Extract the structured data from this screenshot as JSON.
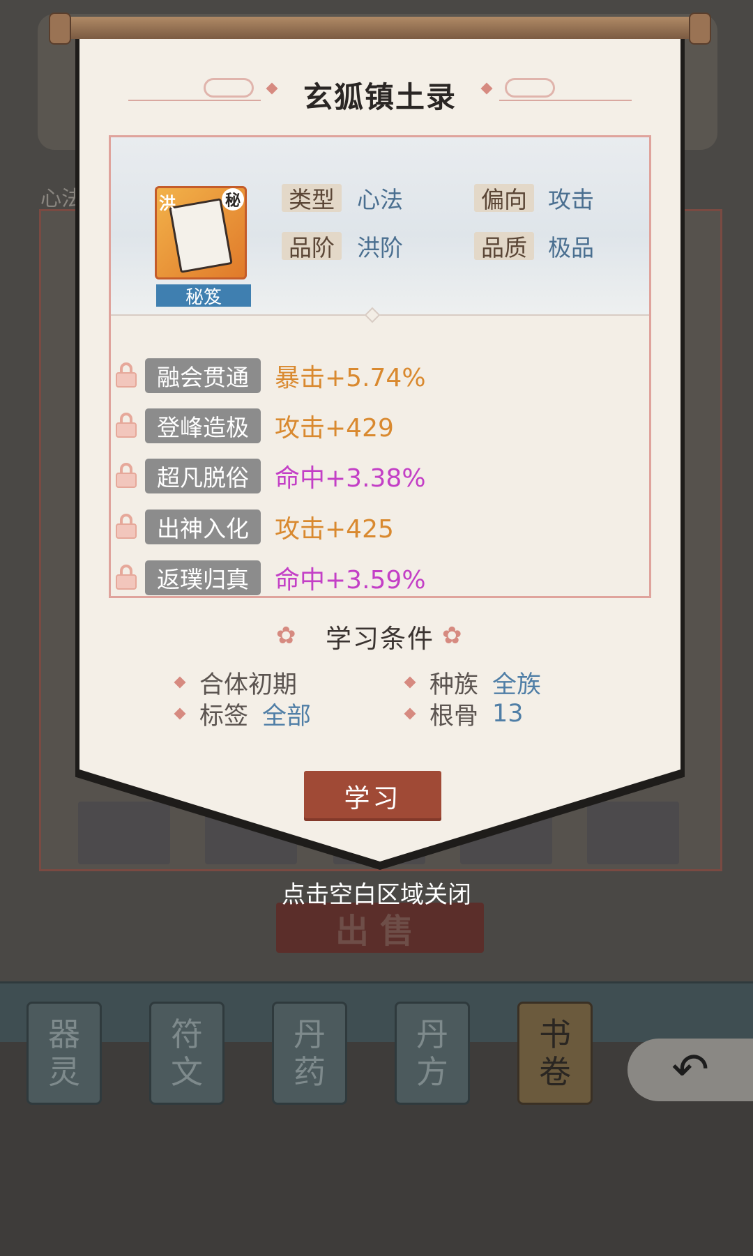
{
  "background": {
    "section_label": "心法",
    "sell_button": "出售",
    "category_tabs": [
      {
        "line1": "器",
        "line2": "灵"
      },
      {
        "line1": "符",
        "line2": "文"
      },
      {
        "line1": "丹",
        "line2": "药"
      },
      {
        "line1": "丹",
        "line2": "方"
      },
      {
        "line1": "书",
        "line2": "卷"
      }
    ],
    "back_icon": "back-arrow-icon"
  },
  "dialog": {
    "title": "玄狐镇土录",
    "item": {
      "grade_char": "洪",
      "secret_char": "秘",
      "badge": "秘笈"
    },
    "attributes": [
      {
        "key": "类型",
        "value": "心法"
      },
      {
        "key": "偏向",
        "value": "攻击"
      },
      {
        "key": "品阶",
        "value": "洪阶"
      },
      {
        "key": "品质",
        "value": "极品"
      }
    ],
    "passives": [
      {
        "name": "融会贯通",
        "effect": "暴击+5.74%",
        "color": "#d9892f"
      },
      {
        "name": "登峰造极",
        "effect": "攻击+429",
        "color": "#d9892f"
      },
      {
        "name": "超凡脱俗",
        "effect": "命中+3.38%",
        "color": "#c33fc6"
      },
      {
        "name": "出神入化",
        "effect": "攻击+425",
        "color": "#d9892f"
      },
      {
        "name": "返璞归真",
        "effect": "命中+3.59%",
        "color": "#c33fc6"
      }
    ],
    "conditions_title": "学习条件",
    "conditions": [
      {
        "label": "合体初期",
        "value": ""
      },
      {
        "label": "种族",
        "value": "全族"
      },
      {
        "label": "标签",
        "value": "全部"
      },
      {
        "label": "根骨",
        "value": "13"
      }
    ],
    "learn_button": "学习"
  },
  "close_hint": "点击空白区域关闭"
}
